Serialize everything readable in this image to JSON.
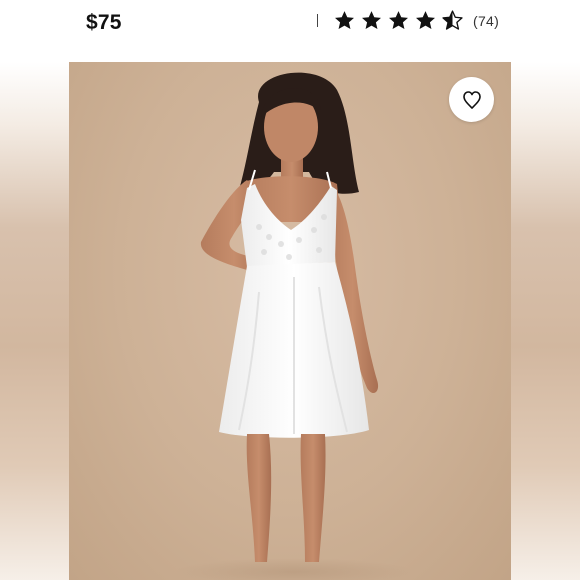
{
  "listing": {
    "price": "$75",
    "rating_stars": 4.5,
    "rating_max": 5,
    "review_count": "(74)"
  },
  "icons": {
    "favorite": "heart-outline-icon",
    "star_full": "star-filled-icon",
    "star_half": "star-half-icon"
  },
  "colors": {
    "photo_background": "#cdb196",
    "star": "#111111",
    "dress": "#ffffff"
  }
}
